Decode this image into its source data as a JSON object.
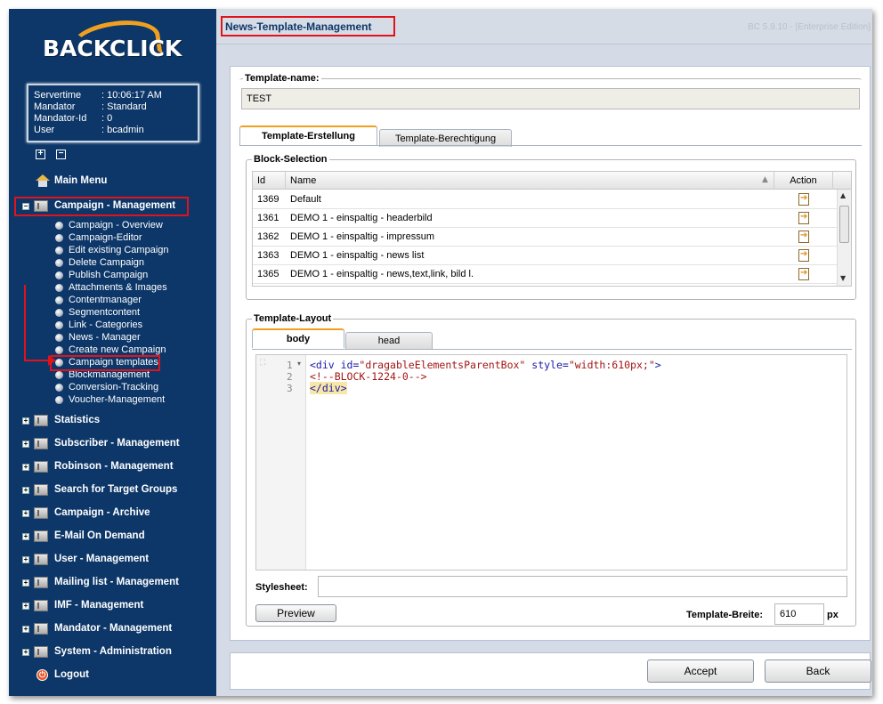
{
  "sidebar": {
    "logo": "BACKCLICK",
    "info": [
      {
        "key": "Servertime",
        "value": ": 10:06:17 AM"
      },
      {
        "key": "Mandator",
        "value": ": Standard"
      },
      {
        "key": "Mandator-Id",
        "value": ": 0"
      },
      {
        "key": "User",
        "value": ": bcadmin"
      }
    ],
    "toggles": [
      "+",
      "−"
    ],
    "main_menu": "Main Menu",
    "campaign_management": "Campaign - Management",
    "sub_items": [
      "Campaign - Overview",
      "Campaign-Editor",
      "Edit existing Campaign",
      "Delete Campaign",
      "Publish Campaign",
      "Attachments & Images",
      "Contentmanager",
      "Segmentcontent",
      "Link - Categories",
      "News - Manager",
      "Create new Campaign",
      "Campaign templates",
      "Blockmanagement",
      "Conversion-Tracking",
      "Voucher-Management"
    ],
    "sections": [
      "Statistics",
      "Subscriber - Management",
      "Robinson - Management",
      "Search for Target Groups",
      "Campaign - Archive",
      "E-Mail On Demand",
      "User - Management",
      "Mailing list - Management",
      "IMF - Management",
      "Mandator - Management",
      "System - Administration"
    ],
    "logout": "Logout"
  },
  "header": {
    "title": "News-Template-Management",
    "version": "BC 5.9.10 - [Enterprise Edition]"
  },
  "form": {
    "template_name_legend": "Template-name:",
    "template_name_value": "TEST",
    "tabs": [
      "Template-Erstellung",
      "Template-Berechtigung"
    ],
    "block_selection": {
      "legend": "Block-Selection",
      "columns": [
        "Id",
        "Name",
        "Action"
      ],
      "rows": [
        {
          "id": "1369",
          "name": "Default"
        },
        {
          "id": "1361",
          "name": "DEMO 1 - einspaltig - headerbild"
        },
        {
          "id": "1362",
          "name": "DEMO 1 - einspaltig - impressum"
        },
        {
          "id": "1363",
          "name": "DEMO 1 - einspaltig - news list"
        },
        {
          "id": "1365",
          "name": "DEMO 1 - einspaltig - news,text,link, bild l."
        }
      ]
    },
    "layout": {
      "legend": "Template-Layout",
      "tabs": [
        "body",
        "head"
      ],
      "line_numbers": [
        "1",
        "2",
        "3"
      ],
      "code": {
        "l1_open": "<div ",
        "l1_attr1": "id=",
        "l1_val1": "\"dragableElementsParentBox\"",
        "l1_attr2": " style=",
        "l1_val2": "\"width:610px;\"",
        "l1_close": ">",
        "l2": "<!--BLOCK-1224-0-->",
        "l3": "</div>"
      },
      "stylesheet_label": "Stylesheet:",
      "stylesheet_value": "",
      "preview_button": "Preview",
      "width_label": "Template-Breite:",
      "width_value": "610",
      "width_unit": "px"
    }
  },
  "footer": {
    "accept": "Accept",
    "back": "Back"
  },
  "colors": {
    "sidebar_bg": "#0d3769",
    "highlight": "#e0131b",
    "accent": "#f0a020"
  }
}
